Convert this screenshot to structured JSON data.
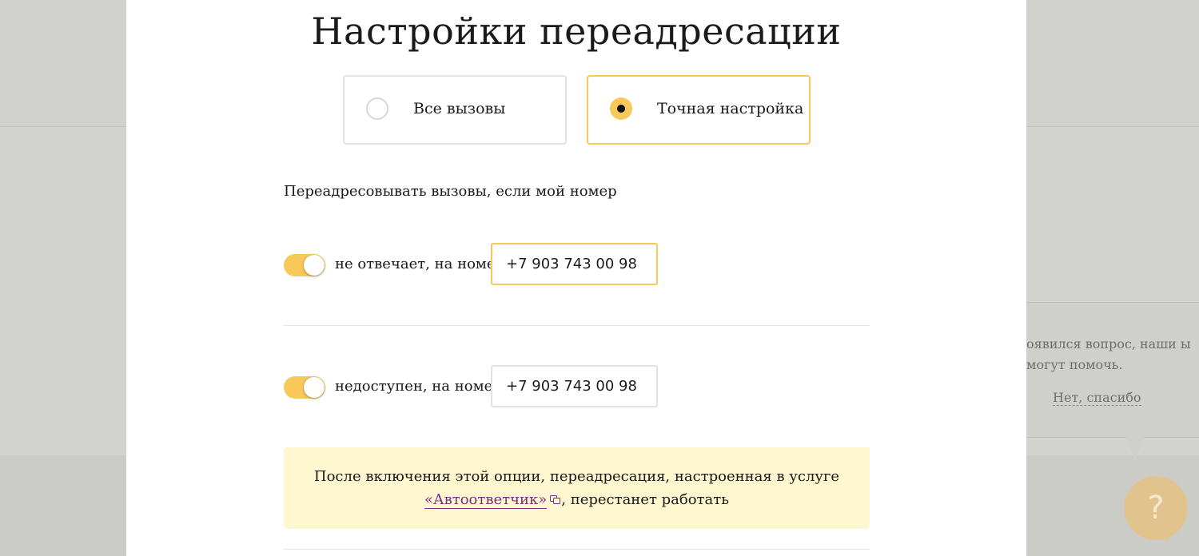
{
  "modal": {
    "title": "Настройки переадресации",
    "modes": {
      "all_calls": "Все вызовы",
      "precise": "Точная настройка",
      "selected": "precise"
    },
    "section_label": "Переадресовывать вызовы, если мой номер",
    "conditions": [
      {
        "label": "не отвечает, на номер",
        "number": "+7 903 743 00 98",
        "enabled": true,
        "focused": true
      },
      {
        "label": "недоступен, на номер",
        "number": "+7 903 743 00 98",
        "enabled": true,
        "focused": false
      }
    ],
    "notice": {
      "line1": "После включения этой опции, переадресация, настроенная в услуге",
      "link": "«Автоответчик»",
      "line2_suffix": ", перестанет работать"
    }
  },
  "chat": {
    "text": "оявился вопрос, наши ы могут помочь.",
    "dismiss": "Нет, спасибо",
    "help_symbol": "?"
  },
  "colors": {
    "accent": "#f8c85a",
    "link": "#7c2d84",
    "notice_bg": "#fff7cf"
  }
}
